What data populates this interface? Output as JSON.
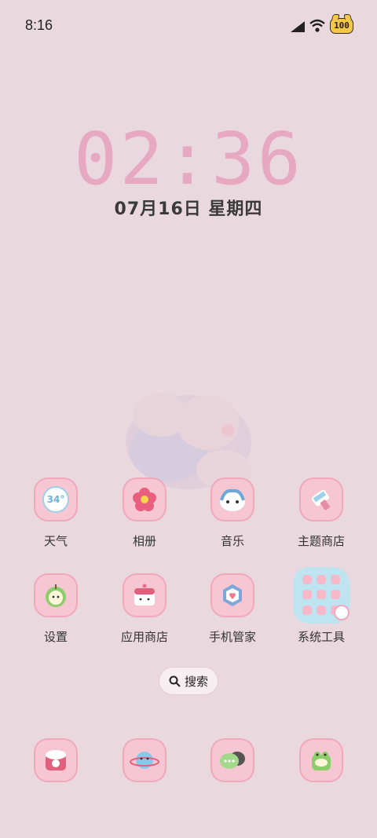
{
  "status_bar": {
    "time": "8:16",
    "battery": "100"
  },
  "clock": {
    "time": "02:36",
    "date": "07月16日 星期四"
  },
  "apps_row1": [
    {
      "label": "天气",
      "icon": "weather-icon",
      "badge": "34°"
    },
    {
      "label": "相册",
      "icon": "flower-icon"
    },
    {
      "label": "音乐",
      "icon": "music-icon"
    },
    {
      "label": "主题商店",
      "icon": "theme-icon"
    }
  ],
  "apps_row2": [
    {
      "label": "设置",
      "icon": "apple-icon"
    },
    {
      "label": "应用商店",
      "icon": "cake-icon"
    },
    {
      "label": "手机管家",
      "icon": "shield-icon"
    },
    {
      "label": "系统工具",
      "icon": "folder-icon"
    }
  ],
  "search": {
    "label": "搜索"
  },
  "dock": [
    {
      "icon": "phone-icon"
    },
    {
      "icon": "browser-planet-icon"
    },
    {
      "icon": "messages-icon"
    },
    {
      "icon": "camera-frog-icon"
    }
  ],
  "colors": {
    "background": "#ead8df",
    "tile": "#f6c6d3",
    "clock": "#e7a9c0",
    "folder": "#bfe4f1"
  }
}
